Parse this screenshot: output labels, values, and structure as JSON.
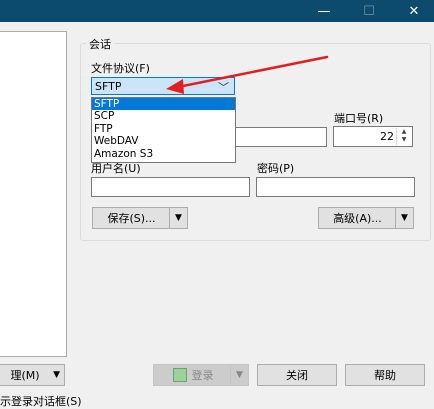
{
  "window": {
    "minimize_icon": "—",
    "maximize_icon": "☐",
    "close_icon": "✕"
  },
  "session": {
    "group_label": "会话",
    "protocol_label": "文件协议(F)",
    "protocol_value": "SFTP",
    "protocol_options": [
      "SFTP",
      "SCP",
      "FTP",
      "WebDAV",
      "Amazon S3"
    ],
    "port_label": "端口号(R)",
    "port_value": "22",
    "username_label": "用户名(U)",
    "password_label": "密码(P)",
    "save_label": "保存(S)...",
    "advanced_label": "高级(A)..."
  },
  "footer": {
    "manage_label": "理(M)",
    "login_label": "登录",
    "close_label": "关闭",
    "help_label": "帮助",
    "show_login_label": "示登录对话框(S)"
  },
  "colors": {
    "titlebar": "#0d4b6e",
    "annotation_arrow": "#e02020",
    "selection": "#0078d7"
  }
}
